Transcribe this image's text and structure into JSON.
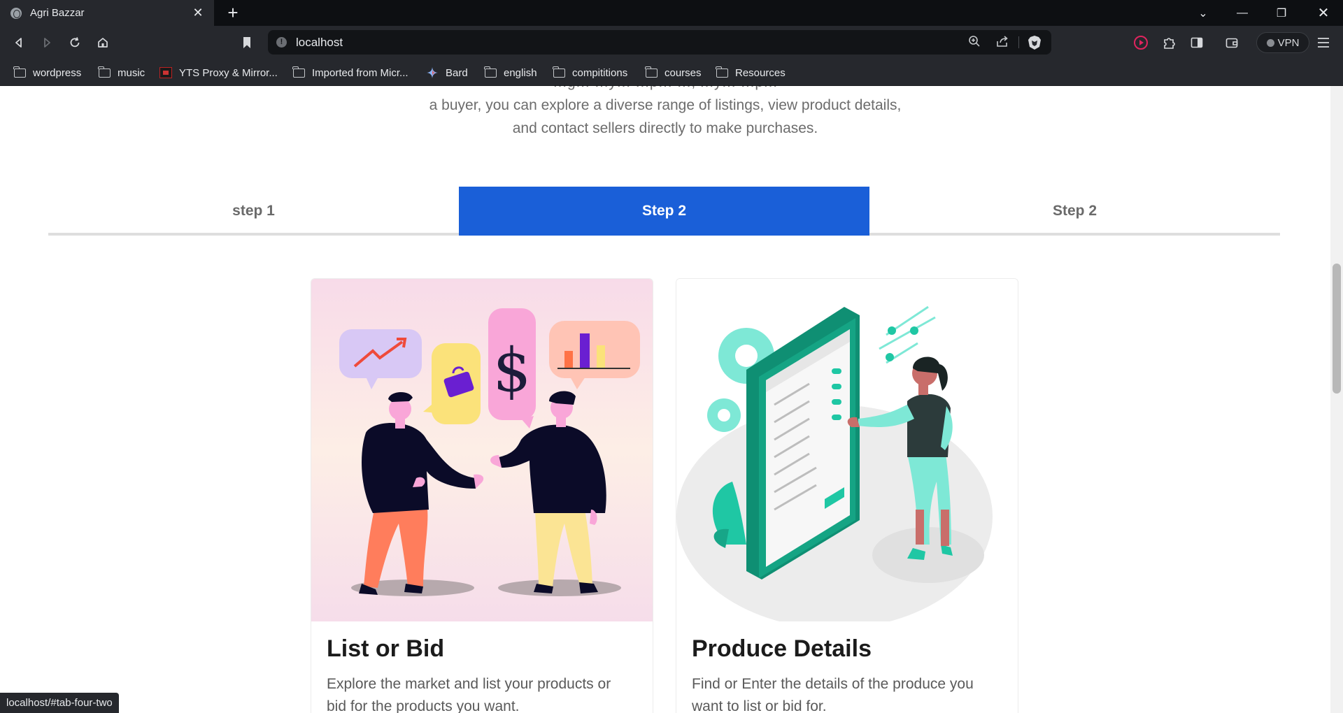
{
  "browser": {
    "tab_title": "Agri Bazzar",
    "tab_close": "✕",
    "new_tab": "+",
    "url": "localhost",
    "vpn_label": "VPN",
    "status_url": "localhost/#tab-four-two",
    "bookmarks": [
      {
        "label": "wordpress",
        "icon": "folder-icon"
      },
      {
        "label": "music",
        "icon": "folder-icon"
      },
      {
        "label": "YTS Proxy & Mirror...",
        "icon": "yts-icon"
      },
      {
        "label": "Imported from Micr...",
        "icon": "folder-icon"
      },
      {
        "label": "Bard",
        "icon": "bard-icon"
      },
      {
        "label": "english",
        "icon": "folder-icon"
      },
      {
        "label": "compititions",
        "icon": "folder-icon"
      },
      {
        "label": "courses",
        "icon": "folder-icon"
      },
      {
        "label": "Resources",
        "icon": "folder-icon"
      }
    ]
  },
  "intro": {
    "line1_partial": "…g… …y… …p… …, …y… …p…",
    "line2": "a buyer, you can explore a diverse range of listings, view product details,",
    "line3": "and contact sellers directly to make purchases."
  },
  "steps": {
    "tabs": [
      {
        "label": "step 1",
        "active": false
      },
      {
        "label": "Step 2",
        "active": true
      },
      {
        "label": "Step 2",
        "active": false
      }
    ]
  },
  "cards": [
    {
      "title": "List or Bid",
      "description": "Explore the market and list your products or bid for the products you want."
    },
    {
      "title": "Produce Details",
      "description": "Find or Enter the details of the produce you want to list or bid for."
    }
  ],
  "colors": {
    "accent": "#1a5fd8",
    "chrome_dark": "#26282d",
    "titlebar": "#0d0f12"
  }
}
